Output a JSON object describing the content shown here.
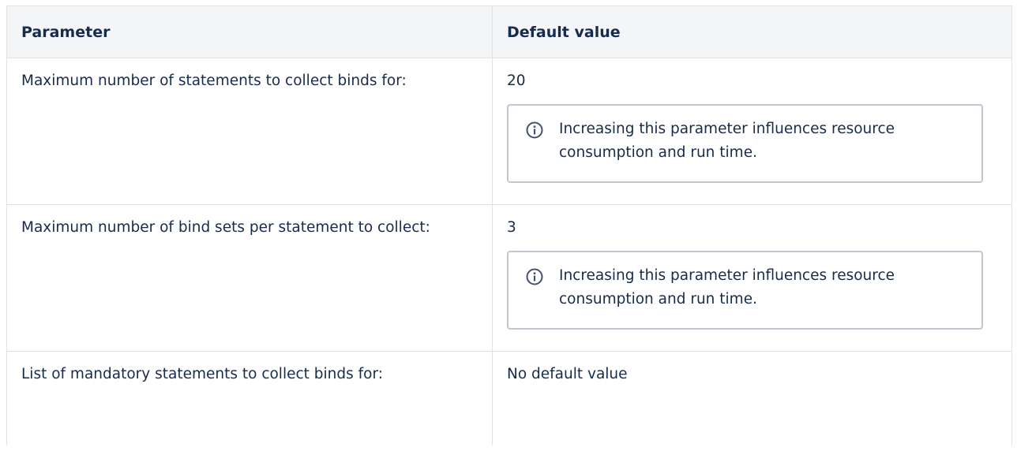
{
  "table": {
    "headers": {
      "parameter": "Parameter",
      "default_value": "Default value"
    },
    "rows": [
      {
        "parameter": "Maximum number of statements to collect binds for:",
        "value": "20",
        "note": "Increasing this parameter influences resource consumption and run time."
      },
      {
        "parameter": "Maximum number of bind sets per statement to collect:",
        "value": "3",
        "note": "Increasing this parameter influences resource consumption and run time."
      },
      {
        "parameter": "List of mandatory statements to collect binds for:",
        "value": "No default value"
      }
    ]
  },
  "icons": {
    "info": "info-icon"
  },
  "colors": {
    "text": "#172b4d",
    "header_bg": "#f4f5f7",
    "border": "#dfe1e6",
    "panel_border": "#c1c7d0",
    "icon": "#42526e"
  }
}
